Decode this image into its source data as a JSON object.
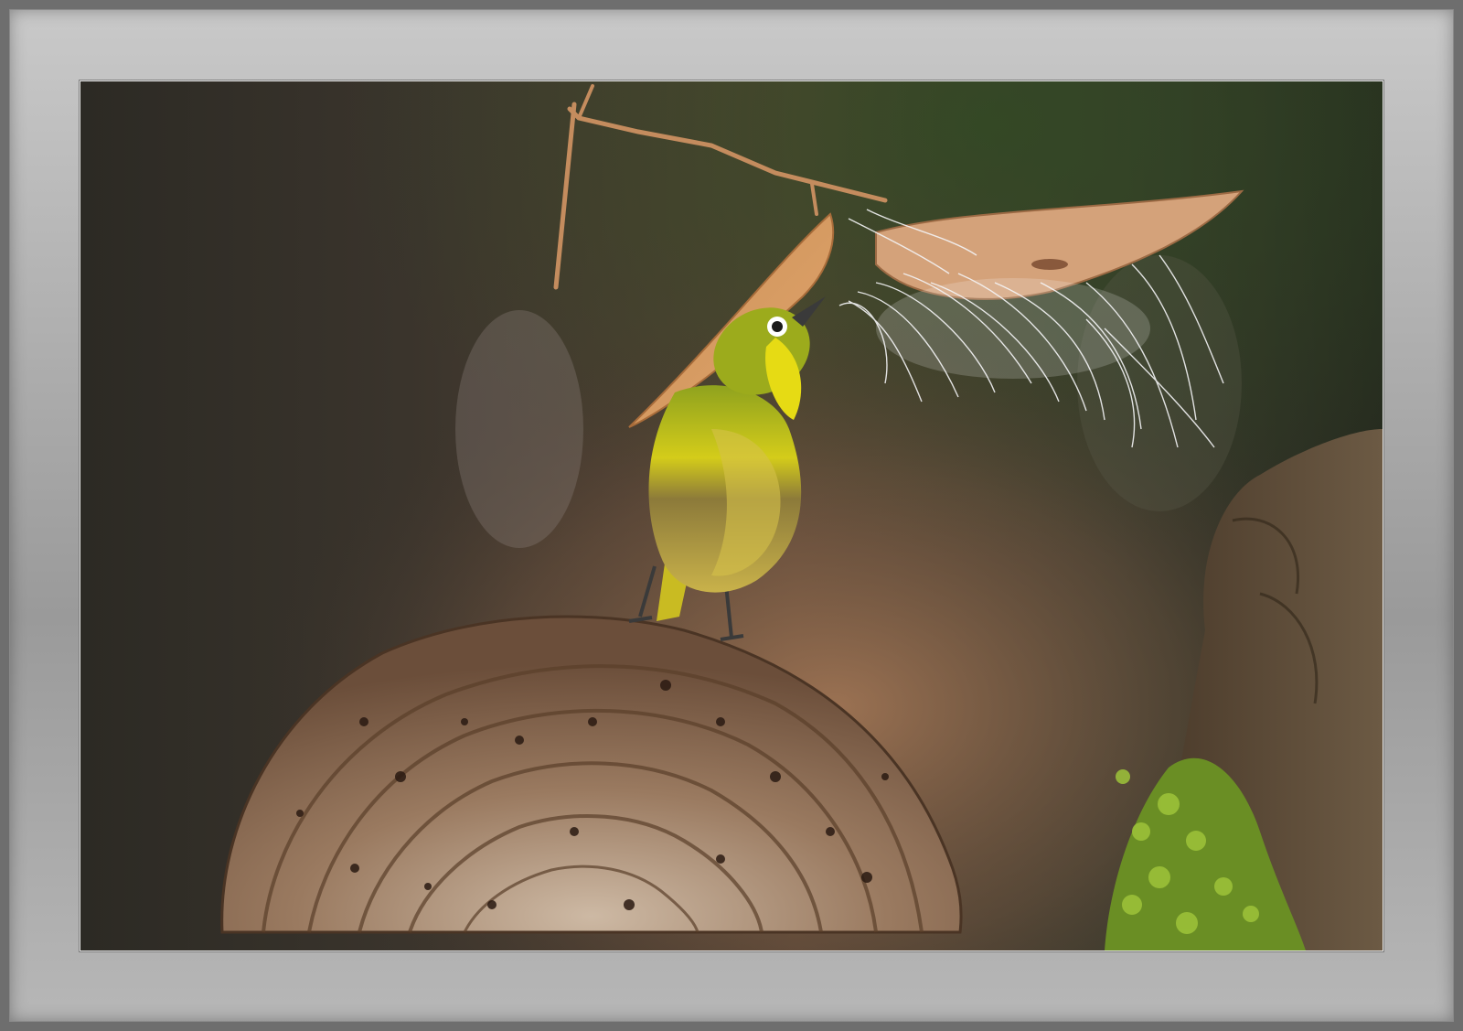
{
  "image": {
    "subject": "bird",
    "colors": {
      "mat_light": "#c9c9c9",
      "mat_dark": "#9a9a9a",
      "background_dark": "#2b2a24",
      "background_warm": "#7a5a44",
      "bird_green": "#8fa21e",
      "bird_yellow": "#d8cf18",
      "fungus": "#8a6a52",
      "moss": "#7fa02a"
    }
  }
}
